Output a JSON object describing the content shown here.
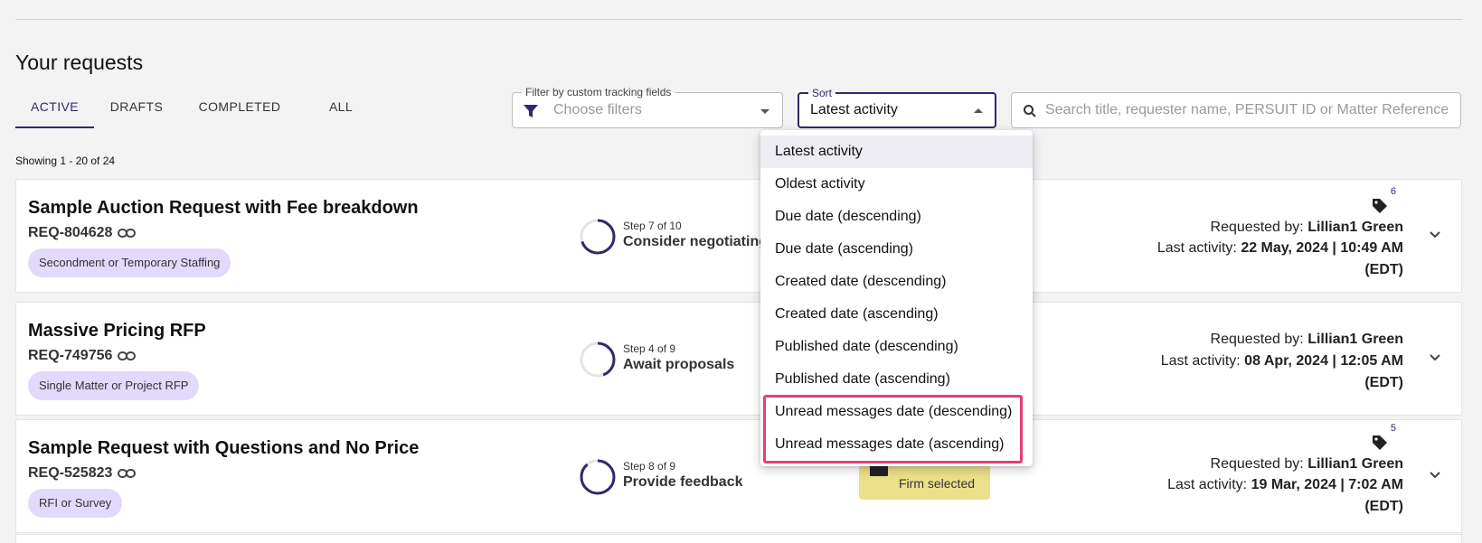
{
  "page": {
    "title": "Your requests",
    "showing": "Showing 1 - 20 of 24"
  },
  "tabs": [
    {
      "label": "ACTIVE",
      "active": true
    },
    {
      "label": "DRAFTS",
      "active": false
    },
    {
      "label": "COMPLETED",
      "active": false
    },
    {
      "label": "ALL",
      "active": false
    }
  ],
  "filter": {
    "legend": "Filter by custom tracking fields",
    "placeholder": "Choose filters",
    "icon": "funnel-icon"
  },
  "sort": {
    "legend": "Sort",
    "value": "Latest activity"
  },
  "search": {
    "placeholder": "Search title, requester name, PERSUIT ID or Matter Reference",
    "icon": "search-icon"
  },
  "sort_menu": {
    "options": [
      "Latest activity",
      "Oldest activity",
      "Due date (descending)",
      "Due date (ascending)",
      "Created date (descending)",
      "Created date (ascending)",
      "Published date (descending)",
      "Published date (ascending)",
      "Unread messages date (descending)",
      "Unread messages date (ascending)"
    ],
    "selected": "Latest activity",
    "highlight_color": "#e63f73"
  },
  "requests": [
    {
      "title": "Sample Auction Request with Fee breakdown",
      "id": "REQ-804628",
      "badge": "Secondment or Temporary Staffing",
      "step_small": "Step 7 of 10",
      "step_big": "Consider negotiating",
      "step_progress": 0.7,
      "tag_count": "6",
      "requested_by_label": "Requested by:",
      "requested_by": "Lillian1 Green",
      "last_activity_label": "Last activity:",
      "last_activity": "22 May, 2024 | 10:49 AM",
      "tz": "(EDT)"
    },
    {
      "title": "Massive Pricing RFP",
      "id": "REQ-749756",
      "badge": "Single Matter or Project RFP",
      "step_small": "Step 4 of 9",
      "step_big": "Await proposals",
      "step_progress": 0.444,
      "requested_by_label": "Requested by:",
      "requested_by": "Lillian1 Green",
      "last_activity_label": "Last activity:",
      "last_activity": "08 Apr, 2024 | 12:05 AM",
      "tz": "(EDT)"
    },
    {
      "title": "Sample Request with Questions and No Price",
      "id": "REQ-525823",
      "badge": "RFI or Survey",
      "step_small": "Step 8 of 9",
      "step_big": "Provide feedback",
      "step_progress": 0.889,
      "status_chip": "Firm selected",
      "tag_count": "5",
      "requested_by_label": "Requested by:",
      "requested_by": "Lillian1 Green",
      "last_activity_label": "Last activity:",
      "last_activity": "19 Mar, 2024 | 7:02 AM",
      "tz": "(EDT)"
    }
  ],
  "colors": {
    "accent": "#2e2a6e",
    "badge": "#e3d9fb",
    "green": "#6ad07c",
    "yellow": "#ece08a"
  }
}
